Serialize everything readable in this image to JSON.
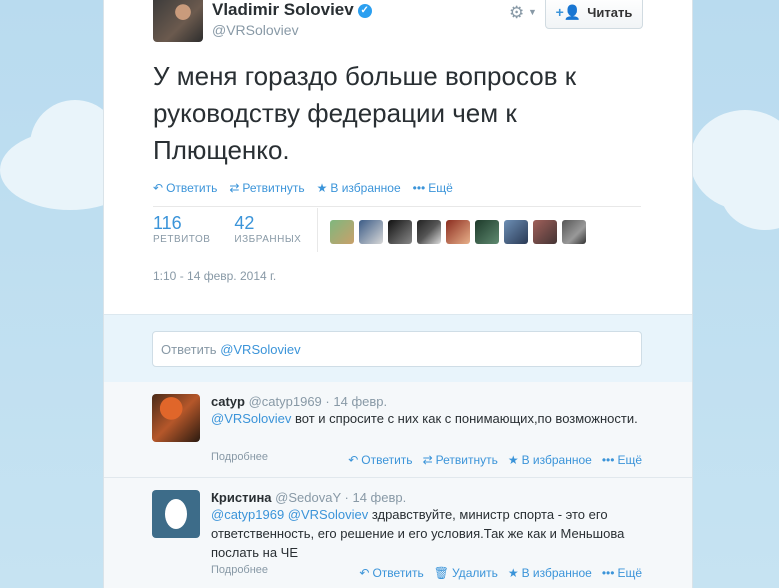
{
  "tweet": {
    "author_name": "Vladimir Soloviev",
    "handle": "@VRSoloviev",
    "follow_label": "Читать",
    "text": "У меня гораздо больше вопросов к руководству федерации чем к Плющенко.",
    "actions": {
      "reply": "Ответить",
      "retweet": "Ретвитнуть",
      "favorite": "В избранное",
      "more": "Ещё"
    },
    "stats": {
      "retweets_count": "116",
      "retweets_label": "РЕТВИТОВ",
      "favorites_count": "42",
      "favorites_label": "ИЗБРАННЫХ"
    },
    "timestamp": "1:10 - 14 февр. 2014 г."
  },
  "reply_box": {
    "placeholder_prefix": "Ответить ",
    "placeholder_mention": "@VRSoloviev"
  },
  "replies": [
    {
      "name": "catyp",
      "handle": "@catyp1969",
      "date": "14 февр.",
      "mentions": "@VRSoloviev",
      "text": " вот и спросите с них как с понимающих,по возможности.",
      "more": "Подробнее",
      "actions": {
        "reply": "Ответить",
        "retweet": "Ретвитнуть",
        "favorite": "В избранное",
        "more": "Ещё"
      }
    },
    {
      "name": "Кристина",
      "handle": "@SedovaY",
      "date": "14 февр.",
      "mentions": "@catyp1969 @VRSoloviev",
      "text": " здравствуйте, министр спорта - это его ответственность, его решение и его условия.Так же как и Меньшова послать на ЧЕ",
      "more": "Подробнее",
      "actions": {
        "reply": "Ответить",
        "delete": "Удалить",
        "favorite": "В избранное",
        "more": "Ещё"
      }
    }
  ],
  "colors": {
    "link": "#3b94d9",
    "text": "#292f33",
    "muted": "#8899a6",
    "verified": "#2b9ff0"
  },
  "icons": [
    "verified-badge-icon",
    "gear-icon",
    "follow-person-icon",
    "reply-icon",
    "retweet-icon",
    "star-icon",
    "more-dots-icon",
    "trash-icon"
  ]
}
